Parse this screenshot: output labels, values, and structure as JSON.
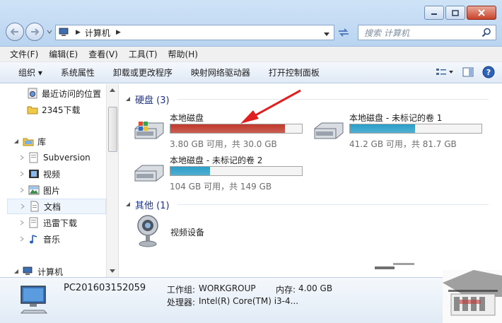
{
  "window": {
    "title_crumb": "计算机",
    "search_placeholder": "搜索 计算机"
  },
  "menu": [
    "文件(F)",
    "编辑(E)",
    "查看(V)",
    "工具(T)",
    "帮助(H)"
  ],
  "toolbar": {
    "organize": "组织 ▾",
    "items": [
      "系统属性",
      "卸载或更改程序",
      "映射网络驱动器",
      "打开控制面板"
    ]
  },
  "sidebar": {
    "recent": "最近访问的位置",
    "downloads2345": "2345下载",
    "library": "库",
    "subversion": "Subversion",
    "video": "视频",
    "pictures": "图片",
    "documents": "文档",
    "xunlei": "迅雷下载",
    "music": "音乐",
    "computer": "计算机"
  },
  "groups": {
    "hdd": "硬盘 (3)",
    "other": "其他 (1)"
  },
  "drives": [
    {
      "name": "本地磁盘",
      "used_fraction": 0.873,
      "fill": "#c0392b",
      "free": "3.80 GB 可用，共 30.0 GB"
    },
    {
      "name": "本地磁盘 - 未标记的卷 1",
      "used_fraction": 0.496,
      "fill": "#2a9ec9",
      "free": "41.2 GB 可用，共 81.7 GB"
    },
    {
      "name": "本地磁盘 - 未标记的卷 2",
      "used_fraction": 0.302,
      "fill": "#2a9ec9",
      "free": "104 GB 可用，共 149 GB"
    }
  ],
  "other_devices": {
    "webcam": "视频设备"
  },
  "status": {
    "pc_name": "PC201603152059",
    "workgroup_label": "工作组:",
    "workgroup": "WORKGROUP",
    "memory_label": "内存:",
    "memory": "4.00 GB",
    "cpu_label": "处理器:",
    "cpu": "Intel(R) Core(TM) i3-4..."
  },
  "colors": {
    "accent": "#1e3287",
    "annotation_arrow": "#e02020"
  }
}
